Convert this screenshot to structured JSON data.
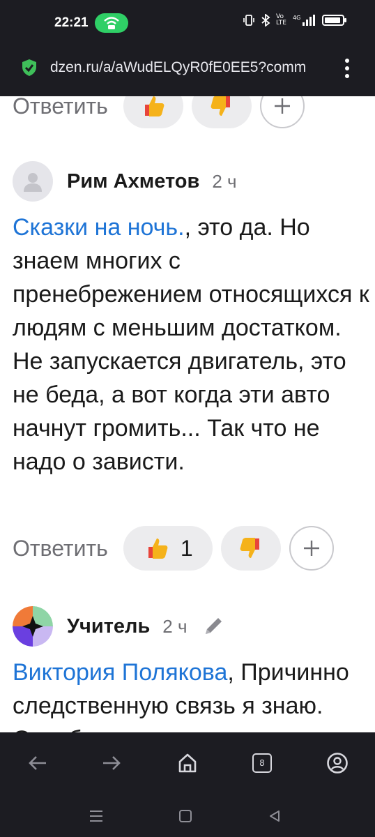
{
  "status_bar": {
    "time": "22:21",
    "network": "4G",
    "signal_label": "Vo LTE"
  },
  "browser": {
    "url": "dzen.ru/a/aWudELQyR0fE0EE5?comm",
    "tab_count": "8"
  },
  "colors": {
    "mention": "#1e74d6",
    "bar_bg": "#1c1c22",
    "hotspot": "#2fcf66"
  },
  "reply_label": "Ответить",
  "top_actions": {
    "reply": "Ответить"
  },
  "comments": [
    {
      "author": "Рим Ахметов",
      "time_ago": "2 ч",
      "mention": "Сказки на ночь.",
      "text": ", это да. Но знаем многих с пренебрежением относящихся к людям с меньшим достатком. Не запускается двигатель, это не беда, а вот когда эти авто начнут громить... Так что не надо о зависти.",
      "likes": "1",
      "reply": "Ответить"
    },
    {
      "author": "Учитель",
      "time_ago": "2 ч",
      "mention": "Виктория Полякова",
      "text": ", Причинно следственную связь я знаю. Освободилось",
      "edited_icon": "pencil-icon"
    }
  ],
  "icons": [
    "shield-check-icon",
    "wifi-hotspot-icon",
    "vibrate-icon",
    "bluetooth-icon",
    "signal-icon",
    "battery-icon",
    "more-vert-icon",
    "thumbs-up-icon",
    "thumbs-down-icon",
    "plus-icon",
    "back-icon",
    "forward-icon",
    "home-icon",
    "tabs-icon",
    "profile-icon",
    "menu-icon",
    "square-icon",
    "triangle-back-icon"
  ]
}
